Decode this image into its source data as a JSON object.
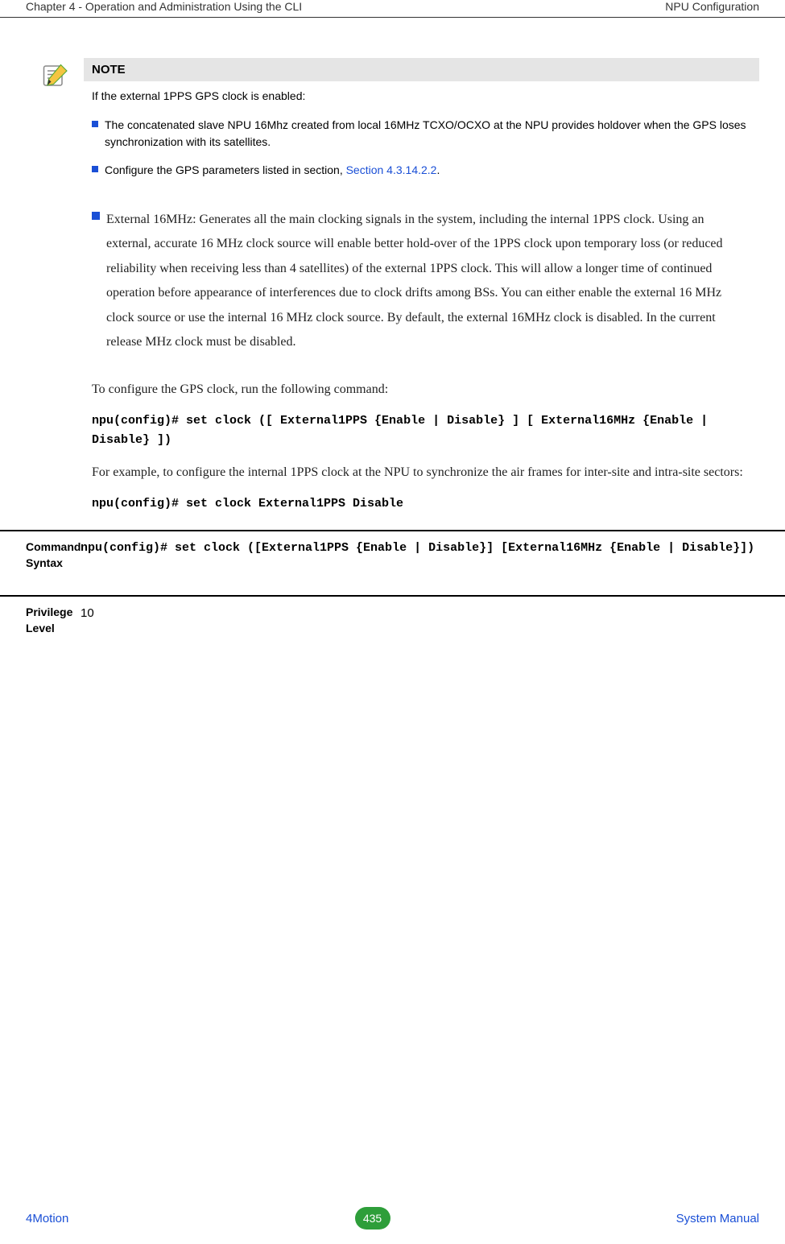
{
  "header": {
    "left": "Chapter 4 - Operation and Administration Using the CLI",
    "right": "NPU Configuration"
  },
  "note": {
    "title": "NOTE",
    "intro": "If the external 1PPS GPS clock is enabled:",
    "bullets": [
      {
        "text": "The concatenated slave NPU 16Mhz created from local 16MHz TCXO/OCXO at the NPU provides holdover when the GPS loses synchronization with its satellites."
      },
      {
        "text_prefix": "Configure the GPS parameters listed in section, ",
        "link": "Section 4.3.14.2.2",
        "text_suffix": "."
      }
    ]
  },
  "main_bullet": "External 16MHz: Generates all the main clocking signals in the system, including the internal 1PPS clock. Using an external, accurate 16 MHz clock source will enable better hold-over of the 1PPS clock upon temporary loss (or reduced reliability when receiving less than 4 satellites) of the external 1PPS clock. This will allow a longer time of continued operation before appearance of interferences due to clock drifts among BSs. You can either enable the external 16 MHz clock source or use the internal 16 MHz clock source. By default, the external 16MHz clock is disabled. In the current release MHz clock must be disabled.",
  "para1": "To configure the GPS clock, run the following command:",
  "cmd1": "npu(config)# set clock ([ External1PPS {Enable | Disable} ] [ External16MHz {Enable | Disable} ])",
  "para2": "For example, to configure the internal 1PPS clock at the NPU to synchronize the air frames for inter-site and intra-site sectors:",
  "cmd2": "npu(config)# set clock External1PPS Disable",
  "table": {
    "row1_label": "Command Syntax",
    "row1_val": "npu(config)# set clock ([External1PPS {Enable | Disable}] [External16MHz {Enable | Disable}])",
    "row2_label": "Privilege Level",
    "row2_val": "10"
  },
  "footer": {
    "brand": "4Motion",
    "page": "435",
    "sysman": "System Manual"
  }
}
